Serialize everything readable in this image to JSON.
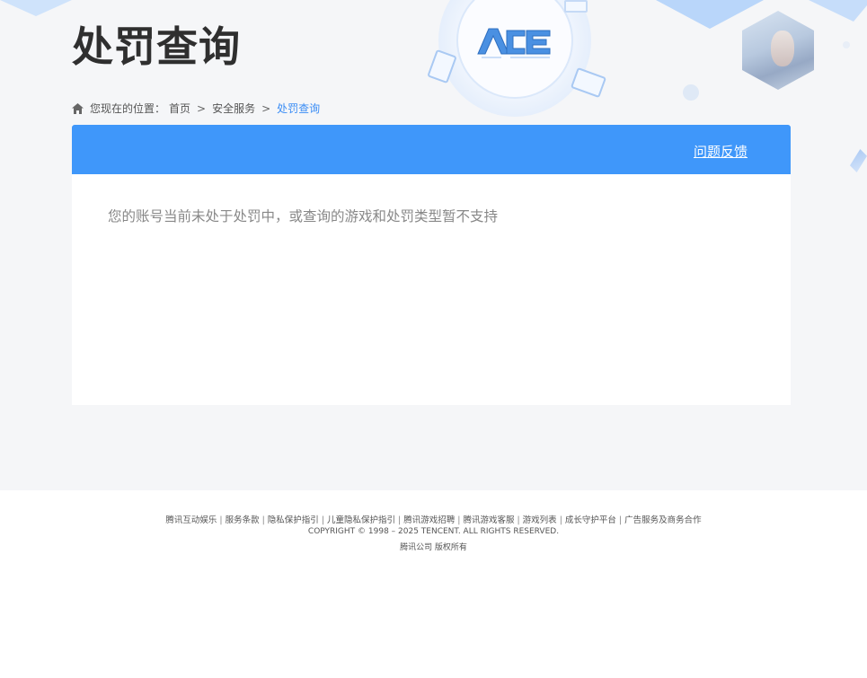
{
  "header": {
    "title": "处罚查询",
    "logo_text": "ACE"
  },
  "breadcrumb": {
    "prefix": "您现在的位置：",
    "items": [
      "首页",
      "安全服务"
    ],
    "separator": ">",
    "current": "处罚查询"
  },
  "panel": {
    "feedback_label": "问题反馈",
    "message": "您的账号当前未处于处罚中，或查询的游戏和处罚类型暂不支持"
  },
  "footer": {
    "links": [
      "腾讯互动娱乐",
      "服务条款",
      "隐私保护指引",
      "儿童隐私保护指引",
      "腾讯游戏招聘",
      "腾讯游戏客服",
      "游戏列表",
      "成长守护平台",
      "广告服务及商务合作"
    ],
    "copyright": "COPYRIGHT © 1998 – 2025 TENCENT. ALL RIGHTS RESERVED.",
    "rights": "腾讯公司 版权所有"
  },
  "colors": {
    "accent": "#3f97fa",
    "page_bg": "#f5f6f8",
    "breadcrumb_current": "#3b8df5"
  },
  "icons": {
    "home": "home-icon",
    "logo": "ace-logo"
  }
}
